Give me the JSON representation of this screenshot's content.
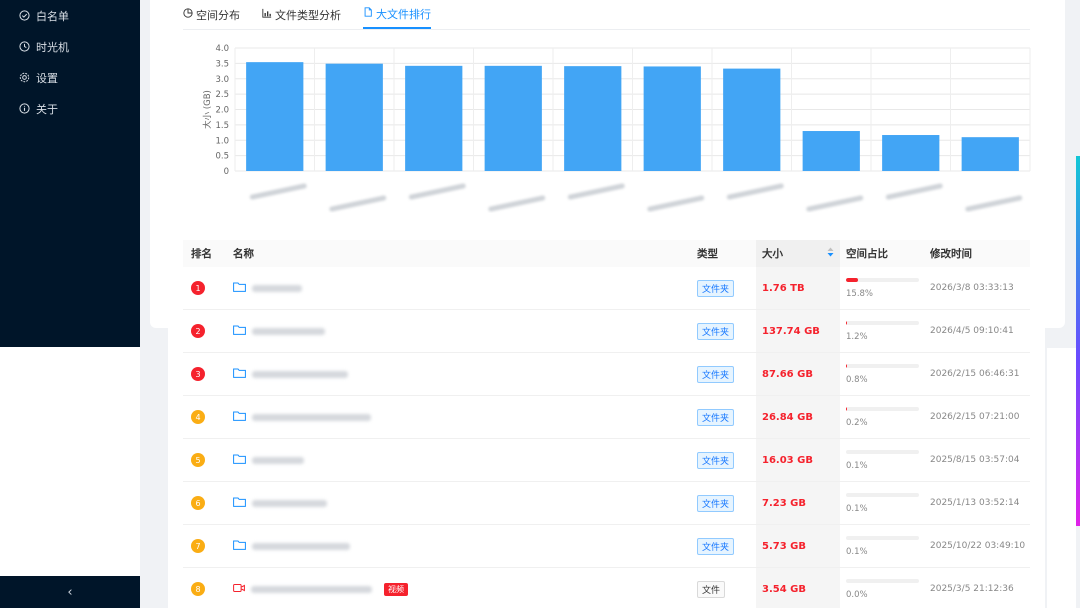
{
  "sidebar": {
    "items": [
      {
        "label": "白名单",
        "icon": "check-circle-icon"
      },
      {
        "label": "时光机",
        "icon": "history-icon"
      },
      {
        "label": "设置",
        "icon": "gear-icon"
      },
      {
        "label": "关于",
        "icon": "info-icon"
      }
    ],
    "collapse_glyph": "‹"
  },
  "tabs": [
    {
      "label": "空间分布",
      "icon": "pie-chart-icon",
      "active": false
    },
    {
      "label": "文件类型分析",
      "icon": "bar-chart-icon",
      "active": false
    },
    {
      "label": "大文件排行",
      "icon": "file-icon",
      "active": true
    }
  ],
  "chart_data": {
    "type": "bar",
    "ylabel": "大小 (GB)",
    "ylim": [
      0,
      4.0
    ],
    "yticks": [
      "0",
      "0.5",
      "1.0",
      "1.5",
      "2.0",
      "2.5",
      "3.0",
      "3.5",
      "4.0"
    ],
    "values": [
      3.54,
      3.49,
      3.42,
      3.42,
      3.41,
      3.4,
      3.33,
      1.3,
      1.17,
      1.1
    ],
    "bar_color": "#42a5f5",
    "grid": true
  },
  "table": {
    "headers": {
      "rank": "排名",
      "name": "名称",
      "type": "类型",
      "size": "大小",
      "ratio": "空间占比",
      "time": "修改时间"
    },
    "rows": [
      {
        "rank": "1",
        "type": "文件夹",
        "size": "1.76 TB",
        "ratio": "15.8%",
        "fill": 0.158,
        "time": "2026/3/8 03:33:13",
        "icon": "folder-icon",
        "rank_color": "#f5222d"
      },
      {
        "rank": "2",
        "type": "文件夹",
        "size": "137.74 GB",
        "ratio": "1.2%",
        "fill": 0.012,
        "time": "2026/4/5 09:10:41",
        "icon": "folder-icon",
        "rank_color": "#f5222d"
      },
      {
        "rank": "3",
        "type": "文件夹",
        "size": "87.66 GB",
        "ratio": "0.8%",
        "fill": 0.008,
        "time": "2026/2/15 06:46:31",
        "icon": "folder-icon",
        "rank_color": "#f5222d"
      },
      {
        "rank": "4",
        "type": "文件夹",
        "size": "26.84 GB",
        "ratio": "0.2%",
        "fill": 0.002,
        "time": "2026/2/15 07:21:00",
        "icon": "folder-icon",
        "rank_color": "#faad14"
      },
      {
        "rank": "5",
        "type": "文件夹",
        "size": "16.03 GB",
        "ratio": "0.1%",
        "fill": 0.001,
        "time": "2025/8/15 03:57:04",
        "icon": "folder-icon",
        "rank_color": "#faad14"
      },
      {
        "rank": "6",
        "type": "文件夹",
        "size": "7.23 GB",
        "ratio": "0.1%",
        "fill": 0.001,
        "time": "2025/1/13 03:52:14",
        "icon": "folder-icon",
        "rank_color": "#faad14"
      },
      {
        "rank": "7",
        "type": "文件夹",
        "size": "5.73 GB",
        "ratio": "0.1%",
        "fill": 0.001,
        "time": "2025/10/22 03:49:10",
        "icon": "folder-icon",
        "rank_color": "#faad14"
      },
      {
        "rank": "8",
        "type": "文件",
        "size": "3.54 GB",
        "ratio": "0.0%",
        "fill": 0.0,
        "time": "2025/3/5 21:12:36",
        "icon": "video-icon",
        "rank_color": "#faad14",
        "badge": "视频"
      }
    ]
  }
}
